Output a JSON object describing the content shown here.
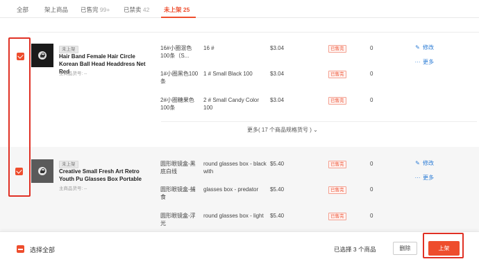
{
  "tabs": [
    {
      "label": "全部",
      "count": ""
    },
    {
      "label": "架上商品",
      "count": ""
    },
    {
      "label": "已售完",
      "count": "99+"
    },
    {
      "label": "已禁卖",
      "count": "42"
    },
    {
      "label": "未上架",
      "count": "25"
    }
  ],
  "products": [
    {
      "badge": "未上架",
      "title": "Hair Band Female Hair Circle Korean Ball Head Headdress Net Red",
      "subtitle": "主商品货号: --",
      "variations": [
        {
          "name": "16#小圈混色100条（S...",
          "sku": "16 #",
          "price": "$3.04",
          "status": "已售完",
          "stock": "0"
        },
        {
          "name": "1#小圈黑色100条",
          "sku": "1 # Small Black 100",
          "price": "$3.04",
          "status": "已售完",
          "stock": "0"
        },
        {
          "name": "2#小圈糖果色100条",
          "sku": "2 # Small Candy Color 100",
          "price": "$3.04",
          "status": "已售完",
          "stock": "0"
        }
      ],
      "more_label": "更多( 17 个商品规格货号 )"
    },
    {
      "badge": "未上架",
      "title": "Creative Small Fresh Art Retro Youth Pu Glasses Box Portable",
      "subtitle": "主商品货号: --",
      "variations": [
        {
          "name": "圆形眼镜盒-黑底白线",
          "sku": "round glasses box - black with",
          "price": "$5.40",
          "status": "已售完",
          "stock": "0"
        },
        {
          "name": "圆形眼镜盒-捕食",
          "sku": "glasses box - predator",
          "price": "$5.40",
          "status": "已售完",
          "stock": "0"
        },
        {
          "name": "圆形眼镜盒-浮光",
          "sku": "round glasses box - light",
          "price": "$5.40",
          "status": "已售完",
          "stock": "0"
        }
      ]
    }
  ],
  "actions": {
    "edit": "修改",
    "more": "更多"
  },
  "footer": {
    "select_all": "选择全部",
    "selected_info": "已选择 3 个商品",
    "delete": "删除",
    "publish": "上架"
  },
  "colors": {
    "accent": "#ee4d2d",
    "link": "#2a7bd5",
    "highlight_box": "#e03024"
  },
  "icons": {
    "edit": "edit-icon",
    "more": "dots-icon",
    "lock": "lock-icon",
    "expand": "chevron-down-icon"
  }
}
